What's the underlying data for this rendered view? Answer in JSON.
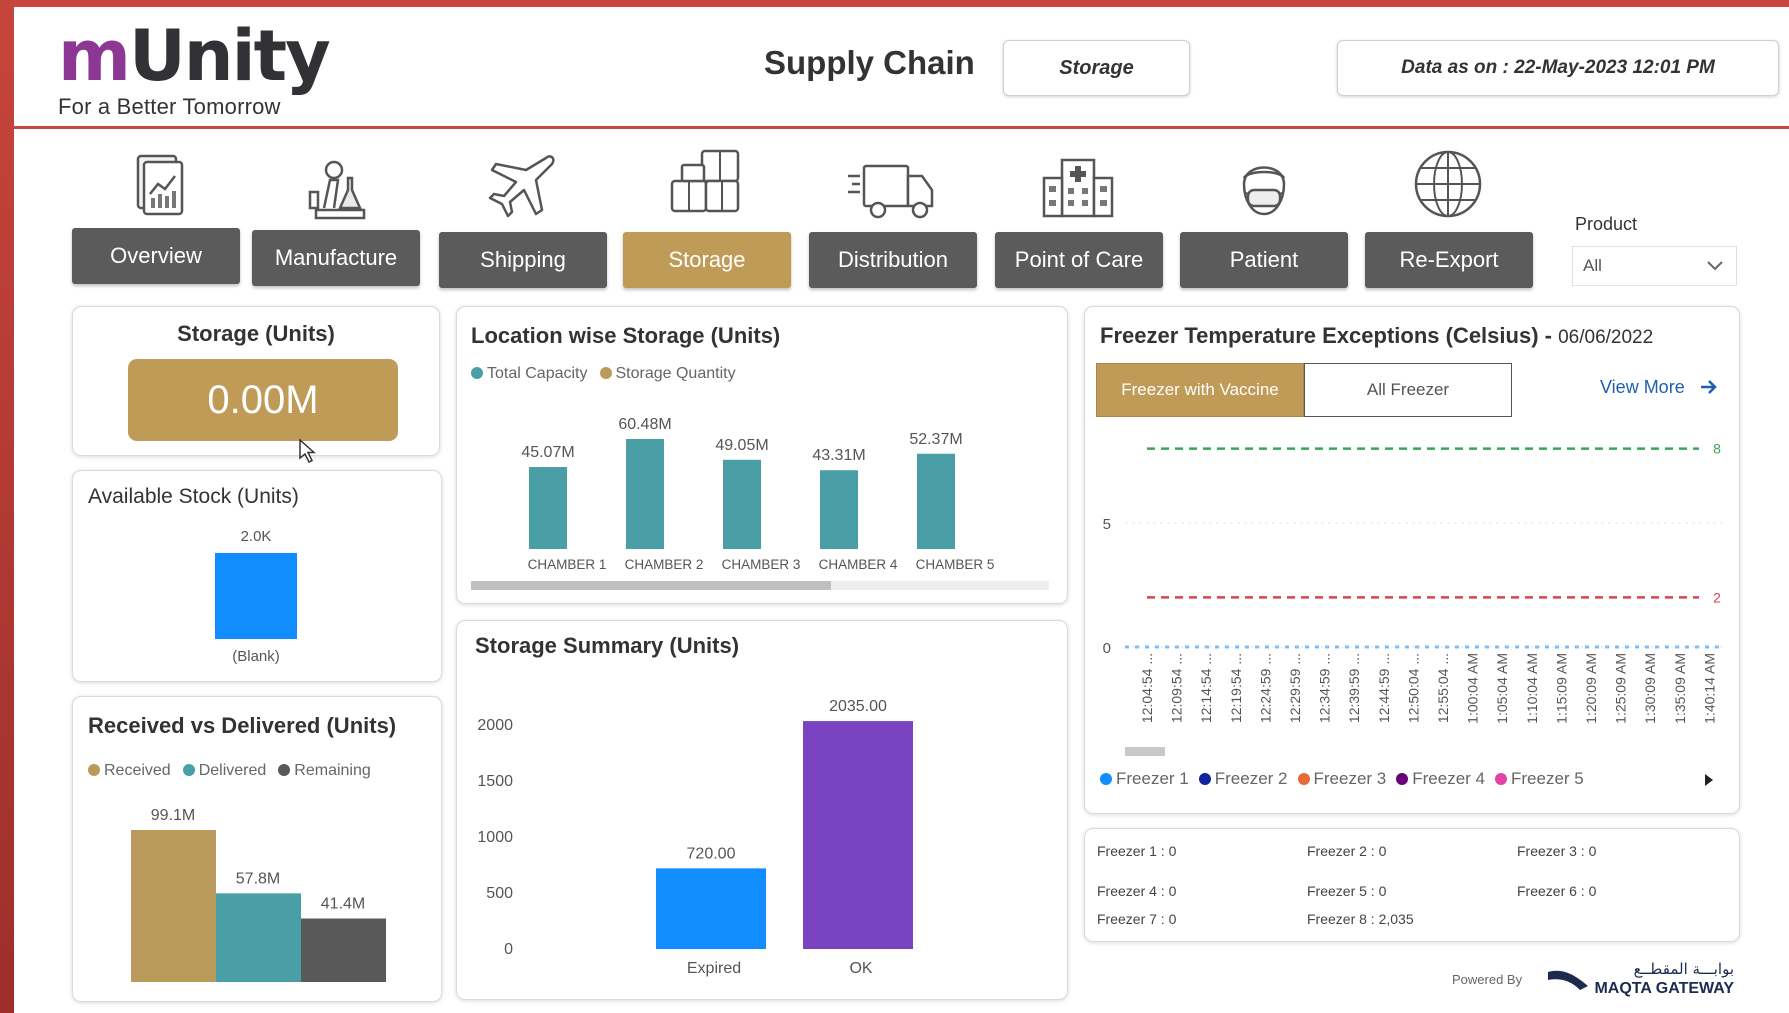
{
  "logo": {
    "brand_m": "m",
    "brand_rest": "Unity",
    "tagline": "For a Better Tomorrow"
  },
  "header": {
    "title": "Supply Chain",
    "section": "Storage",
    "data_as_on": "Data as on : 22-May-2023 12:01 PM"
  },
  "nav": {
    "tabs": [
      {
        "label": "Overview",
        "icon": "chart-report-icon"
      },
      {
        "label": "Manufacture",
        "icon": "lab-icon"
      },
      {
        "label": "Shipping",
        "icon": "airplane-icon"
      },
      {
        "label": "Storage",
        "icon": "boxes-icon",
        "active": true
      },
      {
        "label": "Distribution",
        "icon": "truck-icon"
      },
      {
        "label": "Point of Care",
        "icon": "hospital-icon"
      },
      {
        "label": "Patient",
        "icon": "patient-icon"
      },
      {
        "label": "Re-Export",
        "icon": "globe-icon"
      }
    ],
    "product_label": "Product",
    "product_value": "All"
  },
  "storage_units": {
    "title": "Storage (Units)",
    "value": "0.00M",
    "color": "#bf9b57"
  },
  "available_stock": {
    "title": "Available Stock (Units)"
  },
  "received_delivered": {
    "title": "Received vs Delivered (Units)"
  },
  "location_storage": {
    "title": "Location wise Storage (Units)"
  },
  "storage_summary": {
    "title": "Storage Summary (Units)"
  },
  "freezer": {
    "title": "Freezer Temperature Exceptions (Celsius) -",
    "date": "06/06/2022",
    "toggle_active": "Freezer with Vaccine",
    "toggle_inactive": "All Freezer",
    "view_more": "View More",
    "counts": [
      "Freezer 1 : 0",
      "Freezer 2 : 0",
      "Freezer 3 : 0",
      "Freezer 4 : 0",
      "Freezer 5 : 0",
      "Freezer 6 : 0",
      "Freezer 7 : 0",
      "Freezer 8 : 2,035"
    ]
  },
  "footer": {
    "powered_by": "Powered By",
    "partner_arabic": "بوابـــة المقطــع",
    "partner": "MAQTA GATEWAY"
  },
  "chart_data": [
    {
      "id": "available_stock",
      "type": "bar",
      "categories": [
        "(Blank)"
      ],
      "values": [
        2000
      ],
      "data_labels": [
        "2.0K"
      ],
      "color": "#118dff"
    },
    {
      "id": "received_delivered",
      "type": "bar",
      "categories": [
        "Received",
        "Delivered",
        "Remaining"
      ],
      "values": [
        99.1,
        57.8,
        41.4
      ],
      "data_labels": [
        "99.1M",
        "57.8M",
        "41.4M"
      ],
      "legend": [
        {
          "name": "Received",
          "color": "#b99a5b"
        },
        {
          "name": "Delivered",
          "color": "#4a9fa6"
        },
        {
          "name": "Remaining",
          "color": "#595959"
        }
      ],
      "legend_position": "top-left"
    },
    {
      "id": "location_storage",
      "type": "bar",
      "categories": [
        "CHAMBER 1",
        "CHAMBER 2",
        "CHAMBER 3",
        "CHAMBER 4",
        "CHAMBER 5"
      ],
      "series": [
        {
          "name": "Total Capacity",
          "color": "#4a9fa6",
          "values": [
            45.07,
            60.48,
            49.05,
            43.31,
            52.37
          ]
        },
        {
          "name": "Storage Quantity",
          "color": "#b99a5b",
          "values": [
            0,
            0,
            0,
            0,
            0
          ]
        }
      ],
      "data_labels": [
        "45.07M",
        "60.48M",
        "49.05M",
        "43.31M",
        "52.37M"
      ],
      "legend_position": "top-left"
    },
    {
      "id": "storage_summary",
      "type": "bar",
      "categories": [
        "Expired",
        "OK"
      ],
      "values": [
        720,
        2035
      ],
      "data_labels": [
        "720.00",
        "2035.00"
      ],
      "colors": [
        "#118dff",
        "#7a43c2"
      ],
      "y_ticks": [
        "0",
        "500",
        "1000",
        "1500",
        "2000"
      ],
      "ylim": [
        0,
        2300
      ]
    },
    {
      "id": "freezer_temperature",
      "type": "line",
      "x": [
        "12:04:54 ...",
        "12:09:54 ...",
        "12:14:54 ...",
        "12:19:54 ...",
        "12:24:59 ...",
        "12:29:59 ...",
        "12:34:59 ...",
        "12:39:59 ...",
        "12:44:59 ...",
        "12:50:04 ...",
        "12:55:04 ...",
        "1:00:04 AM",
        "1:05:04 AM",
        "1:10:04 AM",
        "1:15:09 AM",
        "1:20:09 AM",
        "1:25:09 AM",
        "1:30:09 AM",
        "1:35:09 AM",
        "1:40:14 AM"
      ],
      "y_ticks": [
        "0",
        "5"
      ],
      "ylim": [
        0,
        9
      ],
      "reference_lines": [
        {
          "value": 8,
          "label": "8",
          "color": "#3aa655"
        },
        {
          "value": 2,
          "label": "2",
          "color": "#d64550"
        }
      ],
      "series": [
        {
          "name": "Freezer 1",
          "color": "#118dff",
          "values": [
            0,
            0,
            0,
            0,
            0,
            0,
            0,
            0,
            0,
            0,
            0,
            0,
            0,
            0,
            0,
            0,
            0,
            0,
            0,
            0
          ]
        },
        {
          "name": "Freezer 2",
          "color": "#12239e"
        },
        {
          "name": "Freezer 3",
          "color": "#e66c37"
        },
        {
          "name": "Freezer 4",
          "color": "#6b007b"
        },
        {
          "name": "Freezer 5",
          "color": "#e044a7"
        }
      ],
      "legend_position": "bottom"
    }
  ]
}
